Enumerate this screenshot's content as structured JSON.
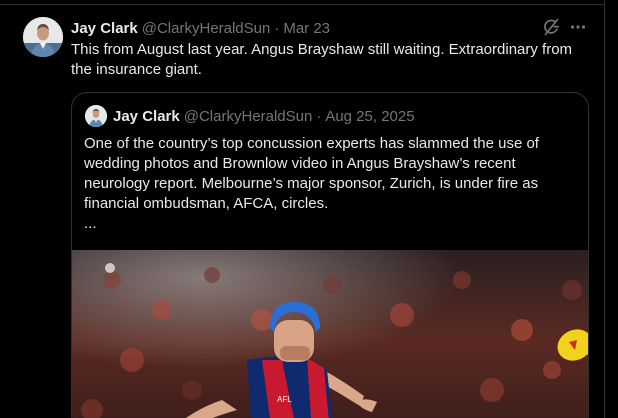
{
  "tweet": {
    "author_name": "Jay Clark",
    "handle": "@ClarkyHeraldSun",
    "separator": "·",
    "date": "Mar 23",
    "text": "This from August last year. Angus Brayshaw still waiting. Extraordinary from the insurance giant."
  },
  "quoted_tweet": {
    "author_name": "Jay Clark",
    "handle": "@ClarkyHeraldSun",
    "separator": "·",
    "date": "Aug 25, 2025",
    "text": "One of the country’s top concussion experts has slammed the use of wedding photos and Brownlow video in Angus Brayshaw’s recent neurology report. Melbourne’s major sponsor, Zurich, is under fire as financial ombudsman, AFCA, circles.",
    "ellipsis": "..."
  },
  "icons": {
    "grok": "grok-icon",
    "more": "more-icon"
  },
  "colors": {
    "background": "#000000",
    "text": "#e7e9ea",
    "muted": "#71767b",
    "border": "#2f3336"
  }
}
